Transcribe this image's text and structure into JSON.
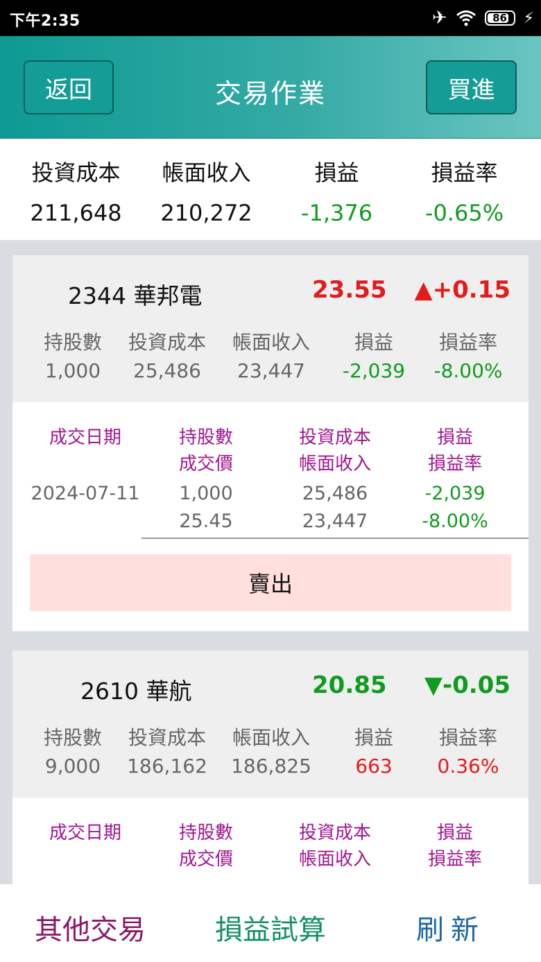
{
  "status": {
    "time": "下午2:35",
    "battery": "86",
    "battery_pct": 86
  },
  "header": {
    "back_label": "返回",
    "title": "交易作業",
    "buy_label": "買進"
  },
  "summary": {
    "labels": [
      "投資成本",
      "帳面收入",
      "損益",
      "損益率"
    ],
    "values": [
      "211,648",
      "210,272",
      "-1,376",
      "-0.65%"
    ]
  },
  "columns": [
    "持股數",
    "投資成本",
    "帳面收入",
    "損益",
    "損益率"
  ],
  "detail_columns": {
    "date": "成交日期",
    "shares_price": [
      "持股數",
      "成交價"
    ],
    "cost_income": [
      "投資成本",
      "帳面收入"
    ],
    "pl_rate": [
      "損益",
      "損益率"
    ]
  },
  "holdings": [
    {
      "code_name": "2344 華邦電",
      "price": "23.55",
      "change": "▲+0.15",
      "values": [
        "1,000",
        "25,486",
        "23,447",
        "-2,039",
        "-8.00%"
      ],
      "trades": [
        {
          "date": "2024-07-11",
          "shares": "1,000",
          "price": "25.45",
          "cost": "25,486",
          "income": "23,447",
          "pl": "-2,039",
          "rate": "-8.00%"
        }
      ],
      "sell_label": "賣出"
    },
    {
      "code_name": "2610 華航",
      "price": "20.85",
      "change": "▼-0.05",
      "values": [
        "9,000",
        "186,162",
        "186,825",
        "663",
        "0.36%"
      ]
    }
  ],
  "bottom_nav": {
    "other": "其他交易",
    "calc": "損益試算",
    "refresh": "刷新"
  },
  "colors": {
    "header": "#35aaa5",
    "gain": "#e31b1b",
    "loss": "#119b1f",
    "purple": "#a0168f"
  }
}
